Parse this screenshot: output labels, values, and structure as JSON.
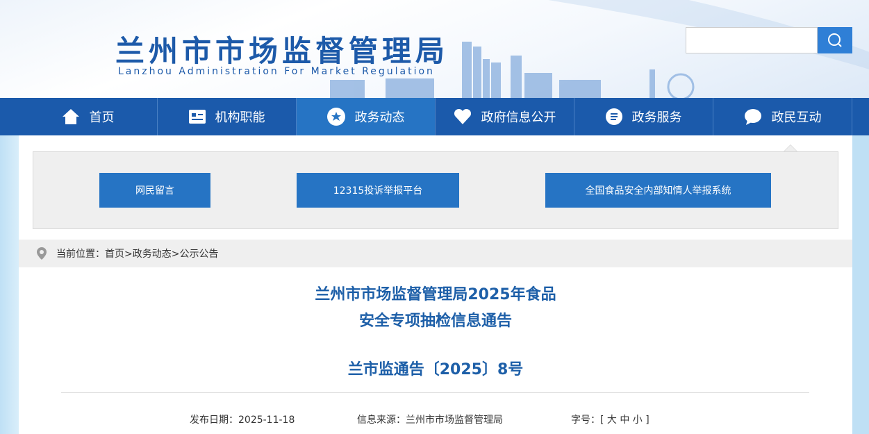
{
  "header": {
    "title_cn": "兰州市市场监督管理局",
    "title_en": "Lanzhou Administration For Market Regulation",
    "search_placeholder": ""
  },
  "nav": [
    {
      "label": "首页",
      "icon": "home-icon"
    },
    {
      "label": "机构职能",
      "icon": "id-card-icon"
    },
    {
      "label": "政务动态",
      "icon": "star-icon"
    },
    {
      "label": "政府信息公开",
      "icon": "heart-icon"
    },
    {
      "label": "政务服务",
      "icon": "list-icon"
    },
    {
      "label": "政民互动",
      "icon": "chat-icon"
    }
  ],
  "quick_links": [
    "网民留言",
    "12315投诉举报平台",
    "全国食品安全内部知情人举报系统"
  ],
  "breadcrumb": "当前位置：首页>政务动态>公示公告",
  "article": {
    "title_line1": "兰州市市场监督管理局2025年食品",
    "title_line2": "安全专项抽检信息通告",
    "doc_number": "兰市监通告〔2025〕8号",
    "date": "发布日期：2025-11-18",
    "source": "信息来源：兰州市市场监督管理局",
    "font_size": "字号：[ 大 中 小 ]"
  }
}
